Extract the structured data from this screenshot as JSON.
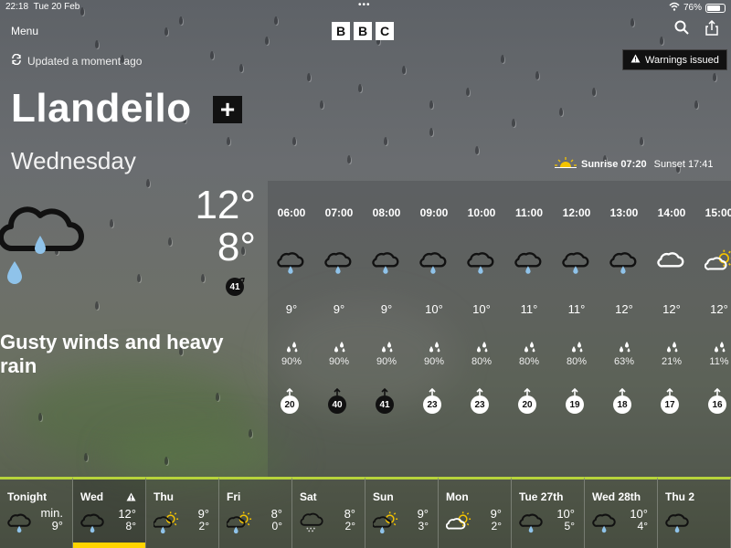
{
  "status_bar": {
    "time": "22:18",
    "date": "Tue 20 Feb",
    "battery": "76%",
    "battery_level": 0.76
  },
  "header": {
    "menu_label": "Menu",
    "logo_letters": [
      "B",
      "B",
      "C"
    ],
    "updated": "Updated a moment ago",
    "warnings_label": "Warnings issued"
  },
  "location": {
    "name": "Llandeilo",
    "add_label": "+"
  },
  "selected_day": {
    "day": "Wednesday",
    "sunrise_label": "Sunrise",
    "sunrise": "07:20",
    "sunset_label": "Sunset",
    "sunset": "17:41",
    "high": "12°",
    "low": "8°",
    "wind": "41",
    "description": "Gusty winds and heavy rain",
    "icon": "heavy-rain-icon"
  },
  "hourly": [
    {
      "time": "06:00",
      "icon": "light-rain-icon",
      "temp": "9°",
      "rain": "90%",
      "wind": "20",
      "wind_style": "light"
    },
    {
      "time": "07:00",
      "icon": "light-rain-icon",
      "temp": "9°",
      "rain": "90%",
      "wind": "40",
      "wind_style": "dark"
    },
    {
      "time": "08:00",
      "icon": "light-rain-icon",
      "temp": "9°",
      "rain": "90%",
      "wind": "41",
      "wind_style": "dark"
    },
    {
      "time": "09:00",
      "icon": "light-rain-icon",
      "temp": "10°",
      "rain": "90%",
      "wind": "23",
      "wind_style": "light"
    },
    {
      "time": "10:00",
      "icon": "light-rain-icon",
      "temp": "10°",
      "rain": "80%",
      "wind": "23",
      "wind_style": "light"
    },
    {
      "time": "11:00",
      "icon": "light-rain-icon",
      "temp": "11°",
      "rain": "80%",
      "wind": "20",
      "wind_style": "light"
    },
    {
      "time": "12:00",
      "icon": "light-rain-icon",
      "temp": "11°",
      "rain": "80%",
      "wind": "19",
      "wind_style": "light"
    },
    {
      "time": "13:00",
      "icon": "light-rain-icon",
      "temp": "12°",
      "rain": "63%",
      "wind": "18",
      "wind_style": "light"
    },
    {
      "time": "14:00",
      "icon": "cloud-icon",
      "temp": "12°",
      "rain": "21%",
      "wind": "17",
      "wind_style": "light"
    },
    {
      "time": "15:00",
      "icon": "sun-cloud-icon",
      "temp": "12°",
      "rain": "11%",
      "wind": "16",
      "wind_style": "light"
    }
  ],
  "daily": [
    {
      "name": "Tonight",
      "min_label": "min.",
      "low": "9°",
      "icon": "light-rain-icon"
    },
    {
      "name": "Wed",
      "high": "12°",
      "low": "8°",
      "icon": "light-rain-icon",
      "warning": true,
      "selected": true
    },
    {
      "name": "Thu",
      "high": "9°",
      "low": "2°",
      "icon": "sunny-rain-icon"
    },
    {
      "name": "Fri",
      "high": "8°",
      "low": "0°",
      "icon": "sunny-rain-icon"
    },
    {
      "name": "Sat",
      "high": "8°",
      "low": "2°",
      "icon": "sleet-icon"
    },
    {
      "name": "Sun",
      "high": "9°",
      "low": "3°",
      "icon": "sunny-rain-icon"
    },
    {
      "name": "Mon",
      "high": "9°",
      "low": "2°",
      "icon": "sun-cloud-icon"
    },
    {
      "name": "Tue 27th",
      "high": "10°",
      "low": "5°",
      "icon": "light-rain-icon"
    },
    {
      "name": "Wed 28th",
      "high": "10°",
      "low": "4°",
      "icon": "light-rain-icon"
    },
    {
      "name": "Thu 2",
      "icon": "light-rain-icon"
    }
  ],
  "colors": {
    "accent_green": "#b7d33b",
    "selected_yellow": "#ffd400",
    "rain_blue": "#8fc3ea",
    "sun_yellow": "#f5c400"
  }
}
